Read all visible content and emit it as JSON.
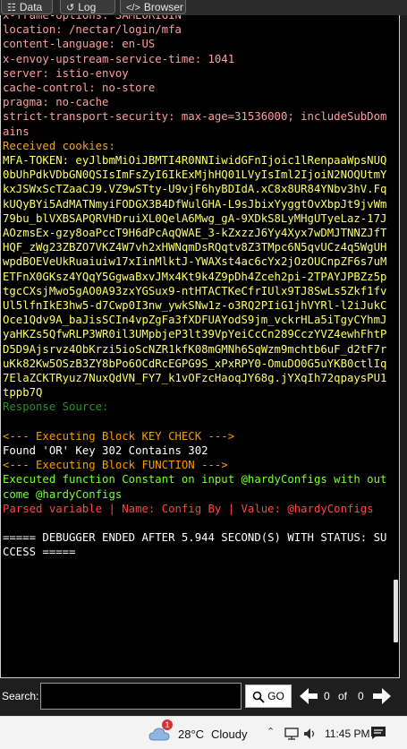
{
  "tabs": [
    {
      "label": "Data",
      "icon": "database-icon",
      "glyph": "☷"
    },
    {
      "label": "Log",
      "icon": "history-icon",
      "glyph": "↺"
    },
    {
      "label": "Browser",
      "icon": "code-icon",
      "glyph": "</>"
    }
  ],
  "console_lines": [
    {
      "text": "x-frame-options: SAMEORIGIN",
      "color": "#ff9e9e"
    },
    {
      "text": "location: /nectar/login/mfa",
      "color": "#ff9e9e"
    },
    {
      "text": "content-language: en-US",
      "color": "#ff9e9e"
    },
    {
      "text": "x-envoy-upstream-service-time: 1041",
      "color": "#ff9e9e"
    },
    {
      "text": "server: istio-envoy",
      "color": "#ff9e9e"
    },
    {
      "text": "cache-control: no-store",
      "color": "#ff9e9e"
    },
    {
      "text": "pragma: no-cache",
      "color": "#ff9e9e"
    },
    {
      "text": "strict-transport-security: max-age=31536000; includeSubDomains",
      "color": "#ff9e9e"
    },
    {
      "text": "Received cookies:",
      "color": "#e8a33d"
    },
    {
      "text": "MFA-TOKEN: eyJlbmMiOiJBMTI4R0NNIiwidGFnIjoic1lRenpaaWpsNUQ0bUhPdkVDbGN0QSIsImFsZyI6IkExMjhHQ01LVyIsIml2IjoiN2NOQUtmYkxJSWxScTZaaCJ9.VZ9wSTty-U9vjF6hyBDIdA.xC8x8UR84YNbv3hV.FqkUQyBYi5AdMATNmyiFODGX3B4DfWulGHA-L9sJbixYyggtOvXbpJt9jvWm79bu_blVXBSAPQRVHDruiXL0QelA6Mwg_gA-9XDkS8LyMHgUTyeLaz-17JAOzmsEx-gzy8oaPccT9H6dPcAqQWAE_3-kZxzzJ6Yy4Xyx7wDMJTNNZJfTHQF_zWg23ZBZO7VKZ4W7vh2xHWNqmDsRQqtv8Z3TMpc6N5qvUCz4q5WgUHwpdBOEVeUkRuaiuiw17xIinMlktJ-YWAXst4ac6cYx2jOzOUCnpZF6s7uMETFnX0GKsz4YQqY5GgwaBxvJMx4Kt9k4Z9pDh4Zceh2pi-2TPAYJPBZz5ptgcCXsjMwo5gAO0A93zxYGSux9-ntHTACTKeCfrIUlx9TJ8SwLs5Zkf1fvUl5lfnIkE3hw5-d7Cwp0I3nw_ywkSNw1z-o3RQ2PIiG1jhVYRl-l2iJukCOce1Qdv9A_baJisSCIn4vpZgFa3fXDFUAYodS9jm_vckrHLa5iTgyCYhmJyaHKZs5QfwRLP3WR0il3UMpbjeP3lt39VpYeiCcCn289CczYVZ4ewhFhtPD5D9Ajsrvz4ObKrzi5ioScNZR1kfK08mGMNh6SqWzm9mchtb6uF_d2tF7ruKk82Kw5OSzB3ZY8bPo6OCdRcEGPG9S_xPxRPY0-OmuDO0G5uYKB0ctlIq7ElaZCKTRyuz7NuxQdVN_FY7_k1vOFzcHaoqJY68g.jYXqIh72qpaysPU1tppb7Q",
      "color": "#ffff66"
    },
    {
      "text": "Response Source:",
      "color": "#2e8b2e"
    },
    {
      "text": "",
      "color": "#ffffff"
    },
    {
      "text": "<--- Executing Block KEY CHECK --->",
      "color": "#ff9900"
    },
    {
      "text": "Found 'OR' Key 302 Contains 302",
      "color": "#ffffff"
    },
    {
      "text": "<--- Executing Block FUNCTION --->",
      "color": "#ff9900"
    },
    {
      "text": "Executed function Constant on input @hardyConfigs with outcome @hardyConfigs",
      "color": "#77ff33"
    },
    {
      "text": "Parsed variable | Name: Config By | Value: @hardyConfigs",
      "color": "#ff4444"
    },
    {
      "text": "",
      "color": "#ffffff"
    },
    {
      "text": "===== DEBUGGER ENDED AFTER 5.944 SECOND(S) WITH STATUS: SUCCESS =====",
      "color": "#ffffff"
    }
  ],
  "search": {
    "label": "Search:",
    "value": "",
    "go_label": "GO",
    "current": "0",
    "of_label": "of",
    "total": "0"
  },
  "taskbar": {
    "weather_badge": "1",
    "temperature": "28°C",
    "condition": "Cloudy",
    "time": "11:45 PM"
  }
}
